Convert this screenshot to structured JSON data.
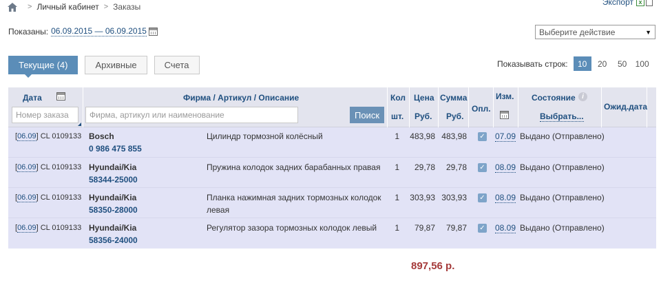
{
  "breadcrumb": {
    "items": [
      "Личный кабинет",
      "Заказы"
    ]
  },
  "export": {
    "label": "Экспорт"
  },
  "shown": {
    "label": "Показаны:",
    "range": "06.09.2015 — 06.09.2015"
  },
  "action_select": {
    "value": "Выберите действие"
  },
  "tabs": [
    {
      "label": "Текущие (4)",
      "active": true
    },
    {
      "label": "Архивные",
      "active": false
    },
    {
      "label": "Счета",
      "active": false
    }
  ],
  "rows_per_page": {
    "label": "Показывать строк:",
    "options": [
      "10",
      "20",
      "50",
      "100"
    ],
    "selected": "10"
  },
  "table": {
    "headers": {
      "date": "Дата",
      "firm": "Фирма / Артикул / Описание",
      "qty": "Кол",
      "qty_unit": "шт.",
      "price": "Цена",
      "price_unit": "Руб.",
      "sum": "Сумма",
      "sum_unit": "Руб.",
      "paid": "Опл.",
      "changed": "Изм.",
      "status": "Состояние",
      "status_select": "Выбрать...",
      "expected": "Ожид.дата"
    },
    "order_input_placeholder": "Номер заказа",
    "search_input_placeholder": "Фирма, артикул или наименование",
    "search_button": "Поиск",
    "rows": [
      {
        "date": "06.09",
        "order": "CL 0109133",
        "brand": "Bosch",
        "article": "0 986 475 855",
        "desc": "Цилиндр тормозной колёсный",
        "desc2": "",
        "qty": "1",
        "price": "483,98",
        "sum": "483,98",
        "changed": "07.09",
        "status": "Выдано (Отправлено)"
      },
      {
        "date": "06.09",
        "order": "CL 0109133",
        "brand": "Hyundai/Kia",
        "article": "58344-25000",
        "desc": "Пружина колодок задних барабанных правая",
        "desc2": "",
        "qty": "1",
        "price": "29,78",
        "sum": "29,78",
        "changed": "08.09",
        "status": "Выдано (Отправлено)"
      },
      {
        "date": "06.09",
        "order": "CL 0109133",
        "brand": "Hyundai/Kia",
        "article": "58350-28000",
        "desc": "Планка нажимная задних тормозных колодок",
        "desc2": "левая",
        "qty": "1",
        "price": "303,93",
        "sum": "303,93",
        "changed": "08.09",
        "status": "Выдано (Отправлено)"
      },
      {
        "date": "06.09",
        "order": "CL 0109133",
        "brand": "Hyundai/Kia",
        "article": "58356-24000",
        "desc": "Регулятор зазора тормозных колодок левый",
        "desc2": "",
        "qty": "1",
        "price": "79,87",
        "sum": "79,87",
        "changed": "08.09",
        "status": "Выдано (Отправлено)"
      }
    ]
  },
  "total": "897,56 р."
}
